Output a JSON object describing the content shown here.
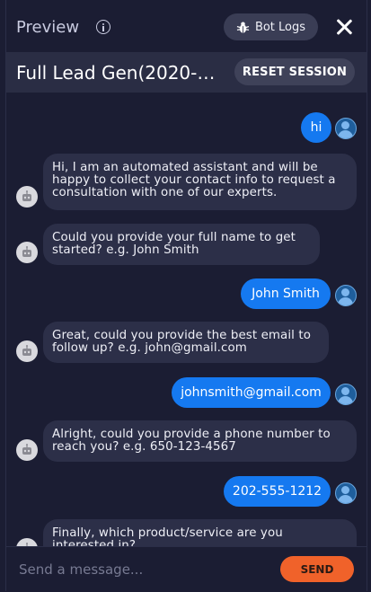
{
  "topbar": {
    "title": "Preview",
    "bot_logs_label": "Bot Logs"
  },
  "header": {
    "flow_name": "Full Lead Gen(2020-…",
    "reset_label": "RESET SESSION"
  },
  "messages": [
    {
      "from": "user",
      "text": "hi"
    },
    {
      "from": "bot",
      "text": "Hi, I am an automated assistant and will be\nhappy to collect your contact info to request a\nconsultation with one of our experts."
    },
    {
      "from": "bot",
      "text": "Could you provide your full name to get\nstarted? e.g. John Smith"
    },
    {
      "from": "user",
      "text": "John Smith"
    },
    {
      "from": "bot",
      "text": "Great, could you provide the best email to\nfollow up? e.g. john@gmail.com"
    },
    {
      "from": "user",
      "text": "johnsmith@gmail.com"
    },
    {
      "from": "bot",
      "text": "Alright, could you provide a phone number to\nreach you? e.g. 650-123-4567"
    },
    {
      "from": "user",
      "text": "202-555-1212"
    },
    {
      "from": "bot",
      "text": "Finally, which product/service are you\ninterested in?"
    }
  ],
  "composer": {
    "placeholder": "Send a message...",
    "send_label": "SEND"
  },
  "colors": {
    "background": "#1b1d33",
    "user_bubble": "#1579f0",
    "bot_bubble": "#2c2f48",
    "send_button": "#f0622a"
  }
}
